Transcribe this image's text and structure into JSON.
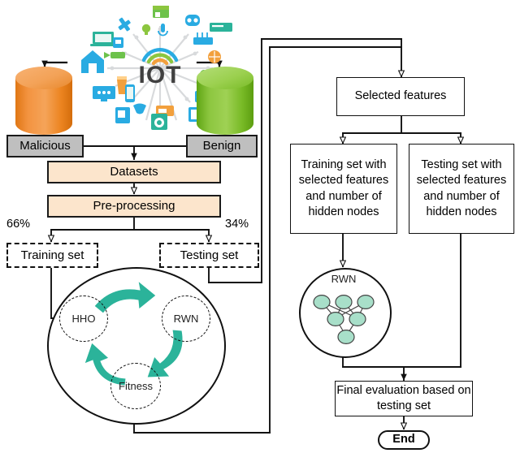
{
  "diagram": {
    "title": "IoT intrusion detection methodology flowchart",
    "colors": {
      "gray_box": "#BFBFBF",
      "peach_box": "#FCE5CC",
      "teal_arrow": "#2BB39A",
      "rwn_node": "#A8DFC9",
      "malicious_cylinder": "#F08A2A",
      "benign_cylinder": "#7DBE2E",
      "stroke": "#111111"
    },
    "iot_logo": {
      "text": "IOT",
      "wifi_arc_colors": [
        "#F2A03D",
        "#8CC63F",
        "#29ABE2"
      ]
    },
    "sources": [
      {
        "id": "malicious",
        "label": "Malicious",
        "cylinder_color": "#F08A2A"
      },
      {
        "id": "benign",
        "label": "Benign",
        "cylinder_color": "#7DBE2E"
      }
    ],
    "pipeline": [
      {
        "id": "datasets",
        "label": "Datasets"
      },
      {
        "id": "preprocessing",
        "label": "Pre-processing"
      }
    ],
    "split": {
      "train_pct": "66%",
      "test_pct": "34%",
      "train_label": "Training set",
      "test_label": "Testing set"
    },
    "cycle": {
      "nodes": [
        {
          "id": "hho",
          "label": "HHO"
        },
        {
          "id": "rwn",
          "label": "RWN"
        },
        {
          "id": "fitness",
          "label": "Fitness"
        }
      ]
    },
    "right_flow": {
      "selected_features": "Selected features",
      "train_with_features": "Training set with selected features and number of hidden nodes",
      "test_with_features": "Testing set with selected features and number of hidden nodes",
      "rwn_model_label": "RWN",
      "final_evaluation": "Final evaluation based on testing set",
      "end": "End"
    }
  }
}
